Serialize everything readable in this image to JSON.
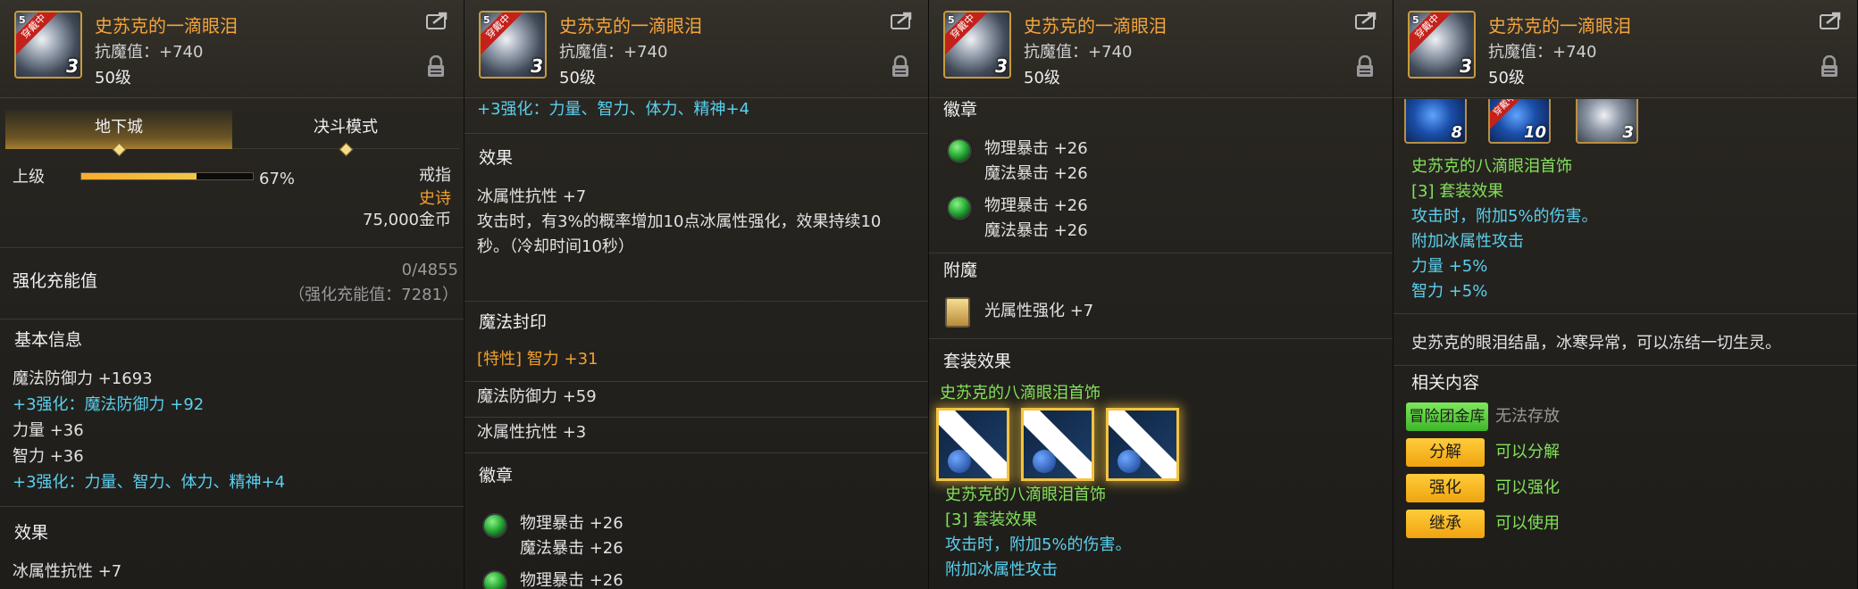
{
  "item": {
    "name": "史苏克的一滴眼泪",
    "stat": "抗魔值：+740",
    "level": "50级",
    "icon_badge": "穿戴中",
    "icon_level": "5",
    "icon_count": "3"
  },
  "p1": {
    "tabs": [
      "地下城",
      "决斗模式"
    ],
    "grade_label": "上级",
    "progress_percent": 67,
    "progress_text": "67%",
    "slot_type": "戒指",
    "rarity": "史诗",
    "price": "75,000金币",
    "charge_label": "强化充能值",
    "charge_value": "0/4855",
    "charge_detail": "（强化充能值：7281）",
    "basic_info_title": "基本信息",
    "basic_stats": [
      "魔法防御力 +1693",
      "+3强化：魔法防御力 +92",
      "力量 +36",
      "智力 +36",
      "+3强化：力量、智力、体力、精神+4"
    ],
    "effect_title": "效果",
    "effect_partial": "冰属性抗性 +7"
  },
  "p2": {
    "top_line": "+3强化：力量、智力、体力、精神+4",
    "effect_title": "效果",
    "effect_lines": [
      "冰属性抗性 +7",
      "攻击时，有3%的概率增加10点冰属性强化，效果持续10",
      "秒。（冷却时间10秒）"
    ],
    "seal_title": "魔法封印",
    "seal_lines": [
      "[特性] 智力 +31",
      "魔法防御力 +59",
      "冰属性抗性 +3"
    ],
    "emblem_title": "徽章",
    "emblem_lines": [
      "物理暴击 +26",
      "魔法暴击 +26",
      "物理暴击 +26"
    ]
  },
  "p3": {
    "emblem_title": "徽章",
    "emblem_groups": [
      [
        "物理暴击 +26",
        "魔法暴击 +26"
      ],
      [
        "物理暴击 +26",
        "魔法暴击 +26"
      ]
    ],
    "enchant_title": "附魔",
    "enchant_line": "光属性强化 +7",
    "set_title": "套装效果",
    "set_name": "史苏克的八滴眼泪首饰",
    "set_name2": "史苏克的八滴眼泪首饰",
    "set_count": "[3] 套装效果",
    "set_effect": "攻击时，附加5%的伤害。",
    "set_effect2": "附加冰属性攻击"
  },
  "p4": {
    "mini_items": [
      {
        "count": "8",
        "badge": ""
      },
      {
        "count": "10",
        "badge": "穿戴中"
      },
      {
        "count": "3",
        "badge": ""
      }
    ],
    "set_name": "史苏克的八滴眼泪首饰",
    "set_count": "[3] 套装效果",
    "set_effects": [
      "攻击时，附加5%的伤害。",
      "附加冰属性攻击",
      "力量 +5%",
      "智力 +5%"
    ],
    "flavor": "史苏克的眼泪结晶，冰寒异常，可以冻结一切生灵。",
    "related_title": "相关内容",
    "related": [
      {
        "badge": "冒险团金库",
        "text": "无法存放",
        "badge_color": "green",
        "text_color": "gray"
      },
      {
        "badge": "分解",
        "text": "可以分解",
        "badge_color": "yellow",
        "text_color": "green"
      },
      {
        "badge": "强化",
        "text": "可以强化",
        "badge_color": "yellow",
        "text_color": "green"
      },
      {
        "badge": "继承",
        "text": "可以使用",
        "badge_color": "yellow",
        "text_color": "green"
      }
    ]
  }
}
